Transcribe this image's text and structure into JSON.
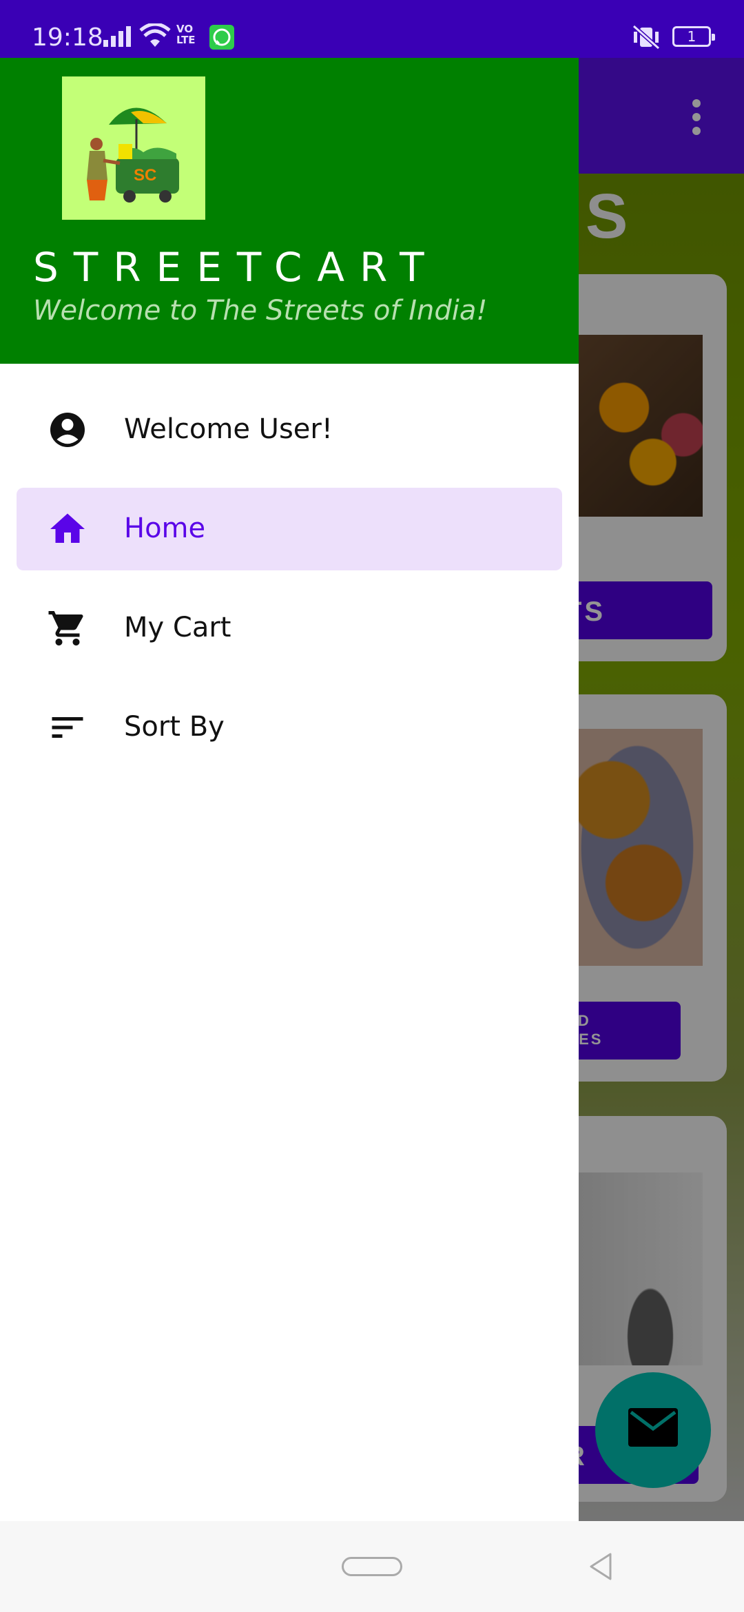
{
  "status_bar": {
    "time": "19:18",
    "network": "VO\nLTE",
    "battery": "1",
    "icons": [
      "signal-icon",
      "wifi-icon",
      "volte-icon",
      "whatsapp-icon",
      "vibrate-off-icon",
      "battery-icon"
    ]
  },
  "drawer": {
    "app_name": "STREETCART",
    "tagline": "Welcome to The Streets of India!",
    "logo_text": "SC",
    "items": [
      {
        "label": "Welcome User!",
        "icon": "account-circle-icon",
        "active": false
      },
      {
        "label": "Home",
        "icon": "home-icon",
        "active": true
      },
      {
        "label": "My Cart",
        "icon": "cart-icon",
        "active": false
      },
      {
        "label": "Sort By",
        "icon": "sort-icon",
        "active": false
      }
    ]
  },
  "background": {
    "heading": "S",
    "buttons": [
      "TS",
      "ND\nGES",
      "R"
    ],
    "fab_icon": "email-icon"
  },
  "colors": {
    "status_bar": "#3a00b5",
    "drawer_header": "#008000",
    "accent": "#5a05e8",
    "active_item_bg": "#ede0fb",
    "fab": "#03c1b3"
  }
}
